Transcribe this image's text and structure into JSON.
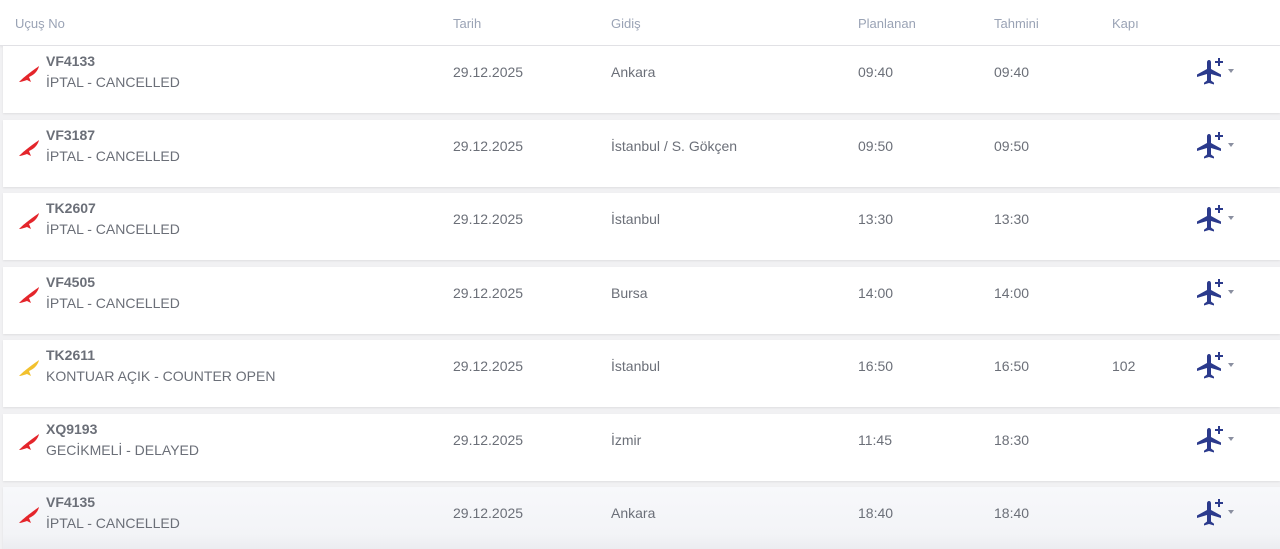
{
  "header": {
    "flight_no": "Uçuş No",
    "date": "Tarih",
    "destination": "Gidiş",
    "scheduled": "Planlanan",
    "estimated": "Tahmini",
    "gate": "Kapı"
  },
  "colors": {
    "mark_red": "#e4252b",
    "mark_yellow": "#f2c12e",
    "plane_navy": "#2b3a8c"
  },
  "rows": [
    {
      "flight": "VF4133",
      "status": "İPTAL - CANCELLED",
      "date": "29.12.2025",
      "destination": "Ankara",
      "scheduled": "09:40",
      "estimated": "09:40",
      "gate": "",
      "mark": "red"
    },
    {
      "flight": "VF3187",
      "status": "İPTAL - CANCELLED",
      "date": "29.12.2025",
      "destination": "İstanbul / S. Gökçen",
      "scheduled": "09:50",
      "estimated": "09:50",
      "gate": "",
      "mark": "red"
    },
    {
      "flight": "TK2607",
      "status": "İPTAL - CANCELLED",
      "date": "29.12.2025",
      "destination": "İstanbul",
      "scheduled": "13:30",
      "estimated": "13:30",
      "gate": "",
      "mark": "red"
    },
    {
      "flight": "VF4505",
      "status": "İPTAL - CANCELLED",
      "date": "29.12.2025",
      "destination": "Bursa",
      "scheduled": "14:00",
      "estimated": "14:00",
      "gate": "",
      "mark": "red"
    },
    {
      "flight": "TK2611",
      "status": "KONTUAR AÇIK - COUNTER OPEN",
      "date": "29.12.2025",
      "destination": "İstanbul",
      "scheduled": "16:50",
      "estimated": "16:50",
      "gate": "102",
      "mark": "yellow"
    },
    {
      "flight": "XQ9193",
      "status": "GECİKMELİ - DELAYED",
      "date": "29.12.2025",
      "destination": "İzmir",
      "scheduled": "11:45",
      "estimated": "18:30",
      "gate": "",
      "mark": "red"
    },
    {
      "flight": "VF4135",
      "status": "İPTAL - CANCELLED",
      "date": "29.12.2025",
      "destination": "Ankara",
      "scheduled": "18:40",
      "estimated": "18:40",
      "gate": "",
      "mark": "red"
    }
  ]
}
